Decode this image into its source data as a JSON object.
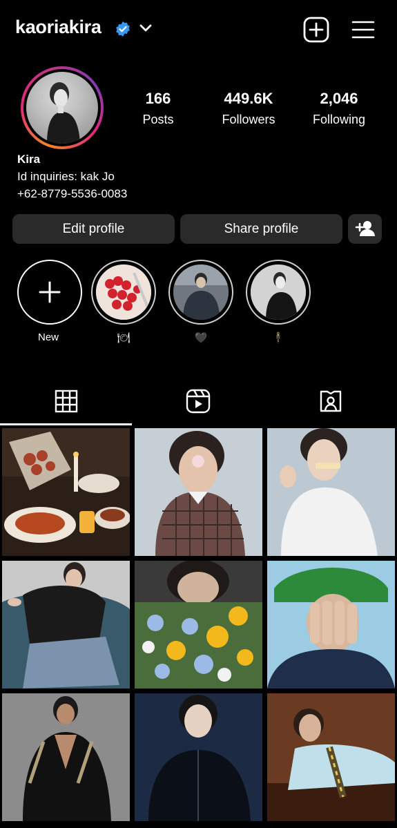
{
  "header": {
    "username": "kaoriakira",
    "verified_icon": "verified-badge-icon",
    "accent": "#3897f0"
  },
  "profile": {
    "stats": [
      {
        "value": "166",
        "label": "Posts"
      },
      {
        "value": "449.6K",
        "label": "Followers"
      },
      {
        "value": "2,046",
        "label": "Following"
      }
    ],
    "name": "Kira",
    "bio_line1": "Id inquiries: kak Jo",
    "bio_line2": "+62-8779-5536-0083"
  },
  "buttons": {
    "edit": "Edit profile",
    "share": "Share profile"
  },
  "highlights": [
    {
      "label": "New"
    },
    {
      "label": "🍽"
    },
    {
      "label": "🖤"
    },
    {
      "label": "🕴"
    }
  ],
  "tabs": [
    "grid-icon",
    "reels-icon",
    "tagged-icon"
  ]
}
